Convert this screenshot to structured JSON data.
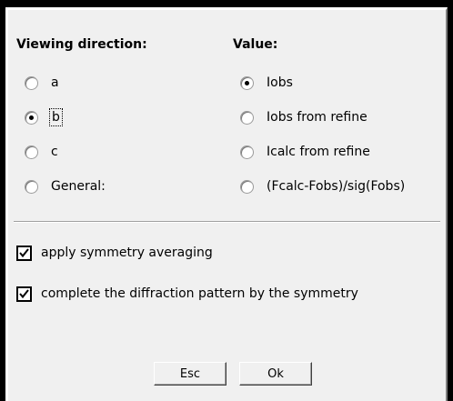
{
  "viewing_direction": {
    "heading": "Viewing direction:",
    "options": [
      "a",
      "b",
      "c",
      "General:"
    ],
    "selected": "b"
  },
  "value": {
    "heading": "Value:",
    "options": [
      "Iobs",
      "Iobs from refine",
      "Icalc from refine",
      "(Fcalc-Fobs)/sig(Fobs)"
    ],
    "selected": "Iobs"
  },
  "checks": {
    "symmetry_averaging": {
      "label": "apply symmetry averaging",
      "checked": true
    },
    "complete_pattern": {
      "label": "complete the diffraction pattern by the symmetry",
      "checked": true
    }
  },
  "buttons": {
    "esc": "Esc",
    "ok": "Ok"
  }
}
